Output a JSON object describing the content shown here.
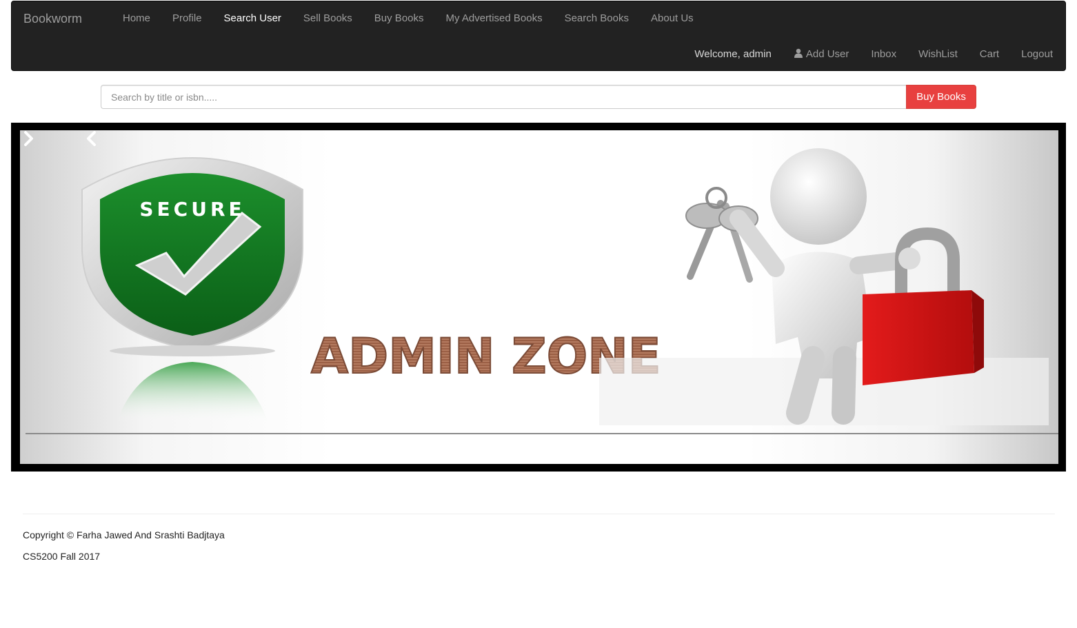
{
  "navbar": {
    "brand": "Bookworm",
    "top_links": [
      "Home",
      "Profile",
      "Search User",
      "Sell Books",
      "Buy Books",
      "My Advertised Books",
      "Search Books",
      "About Us"
    ],
    "active_link": "Search User",
    "welcome": "Welcome, admin",
    "add_user": "Add User",
    "inbox": "Inbox",
    "wishlist": "WishList",
    "cart": "Cart",
    "logout": "Logout"
  },
  "search": {
    "placeholder": "Search by title or isbn.....",
    "value": "",
    "button_label": "Buy Books"
  },
  "carousel": {
    "banner_secure_text": "SECURE",
    "banner_title": "ADMIN ZONE",
    "prev_icon": "chevron-left-icon",
    "next_icon": "chevron-right-icon"
  },
  "footer": {
    "copyright": "Copyright © Farha Jawed And Srashti Badjtaya",
    "course": "CS5200 Fall 2017"
  },
  "colors": {
    "navbar_bg": "#222222",
    "nav_text": "#9d9d9d",
    "accent_red": "#e8403f",
    "shield_green": "#0f7a1e"
  }
}
